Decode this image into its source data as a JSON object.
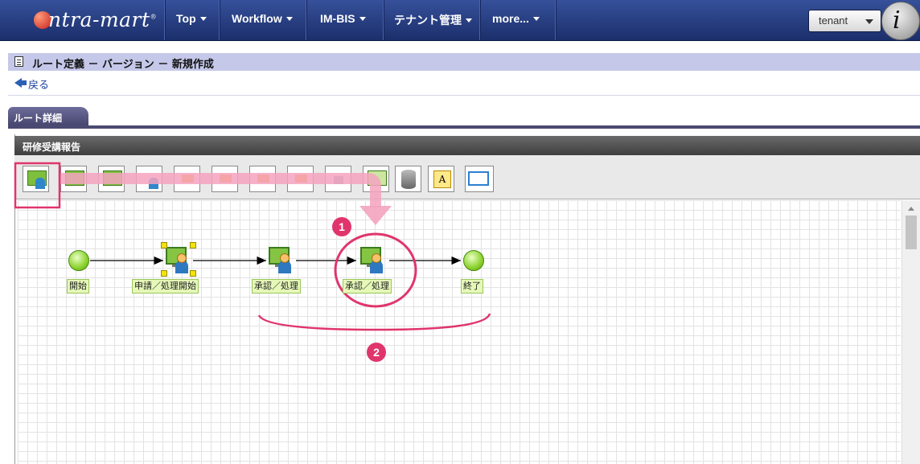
{
  "nav": {
    "logo": "ntra-mart",
    "items": [
      {
        "label": "Top"
      },
      {
        "label": "Workflow"
      },
      {
        "label": "IM-BIS"
      },
      {
        "label": "テナント管理"
      },
      {
        "label": "more..."
      }
    ],
    "tenant_label": "tenant",
    "badge": "i"
  },
  "page": {
    "title": "ルート定義 － バージョン － 新規作成",
    "back_label": "戻る",
    "tab_label": "ルート詳細"
  },
  "panel": {
    "title": "研修受講報告"
  },
  "toolbar": {
    "tools": [
      "user-task",
      "process-node",
      "approval-node",
      "blank",
      "branch",
      "merge",
      "jump",
      "end-jump",
      "system-task",
      "database",
      "note",
      "link"
    ],
    "note_icon_text": "A"
  },
  "diagram": {
    "nodes": [
      {
        "type": "start",
        "label": "開始"
      },
      {
        "type": "task",
        "label": "申請／処理開始",
        "selected": true
      },
      {
        "type": "task",
        "label": "承認／処理"
      },
      {
        "type": "task",
        "label": "承認／処理"
      },
      {
        "type": "end",
        "label": "終了"
      }
    ]
  },
  "annotations": {
    "callout_1": "1",
    "callout_2": "2",
    "accent_color": "#e0356c"
  }
}
